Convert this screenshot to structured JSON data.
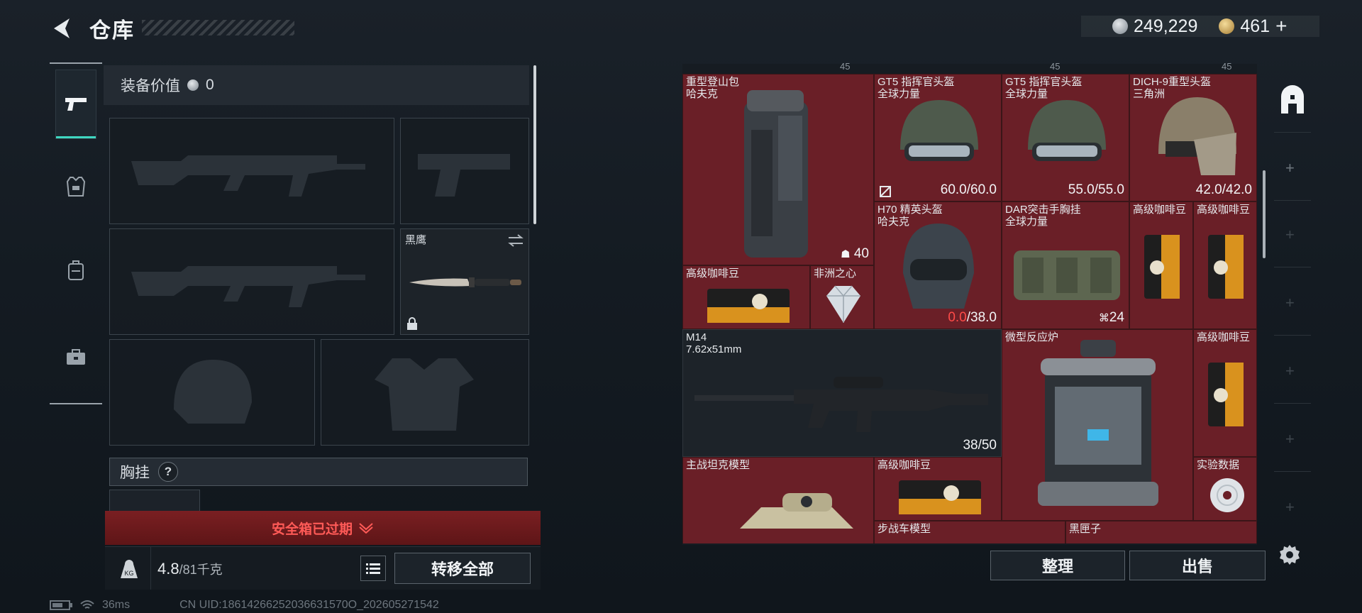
{
  "header": {
    "title": "仓库"
  },
  "currency": {
    "silver_amount": "249,229",
    "gold_amount": "461",
    "gold_add": "+"
  },
  "equipment": {
    "value_label": "装备价值",
    "value_amount": "0",
    "melee_name": "黑鹰",
    "chest_label": "胸挂",
    "chest_help": "?"
  },
  "safebox": {
    "label": "安全箱已过期"
  },
  "inventory": {
    "weight_current": "4.8",
    "weight_max": "/81千克",
    "transfer_all": "转移全部"
  },
  "status": {
    "ping": "36ms",
    "uid": "CN UID:18614266252036631570O_202605271542"
  },
  "storage": {
    "top_counts": [
      "45",
      "45",
      "45"
    ],
    "items": [
      {
        "line1": "重型登山包",
        "line2": "哈夫克",
        "value": "40"
      },
      {
        "line1": "GT5 指挥官头盔",
        "line2": "全球力量",
        "value": "60.0/60.0"
      },
      {
        "line1": "GT5 指挥官头盔",
        "line2": "全球力量",
        "value": "55.0/55.0"
      },
      {
        "line1": "DICH-9重型头盔",
        "line2": "三角洲",
        "value": "42.0/42.0"
      },
      {
        "line1": "H70 精英头盔",
        "line2": "哈夫克",
        "value_red": "0.0",
        "value_rest": "/38.0"
      },
      {
        "line1": "DAR突击手胸挂",
        "line2": "全球力量",
        "value": "24"
      },
      {
        "line1": "高级咖啡豆"
      },
      {
        "line1": "高级咖啡豆"
      },
      {
        "line1": "高级咖啡豆"
      },
      {
        "line1": "非洲之心"
      },
      {
        "line1": "M14",
        "line2": "7.62x51mm",
        "value": "38/50"
      },
      {
        "line1": "微型反应炉"
      },
      {
        "line1": "高级咖啡豆"
      },
      {
        "line1": "主战坦克模型"
      },
      {
        "line1": "高级咖啡豆"
      },
      {
        "line1": "实验数据"
      },
      {
        "line1": "步战车模型"
      },
      {
        "line1": "黑匣子"
      }
    ]
  },
  "actions": {
    "sort": "整理",
    "sell": "出售"
  },
  "colors": {
    "accent": "#3fd7c1",
    "item_bg": "#6a1f27",
    "warning": "#ff5a57"
  }
}
